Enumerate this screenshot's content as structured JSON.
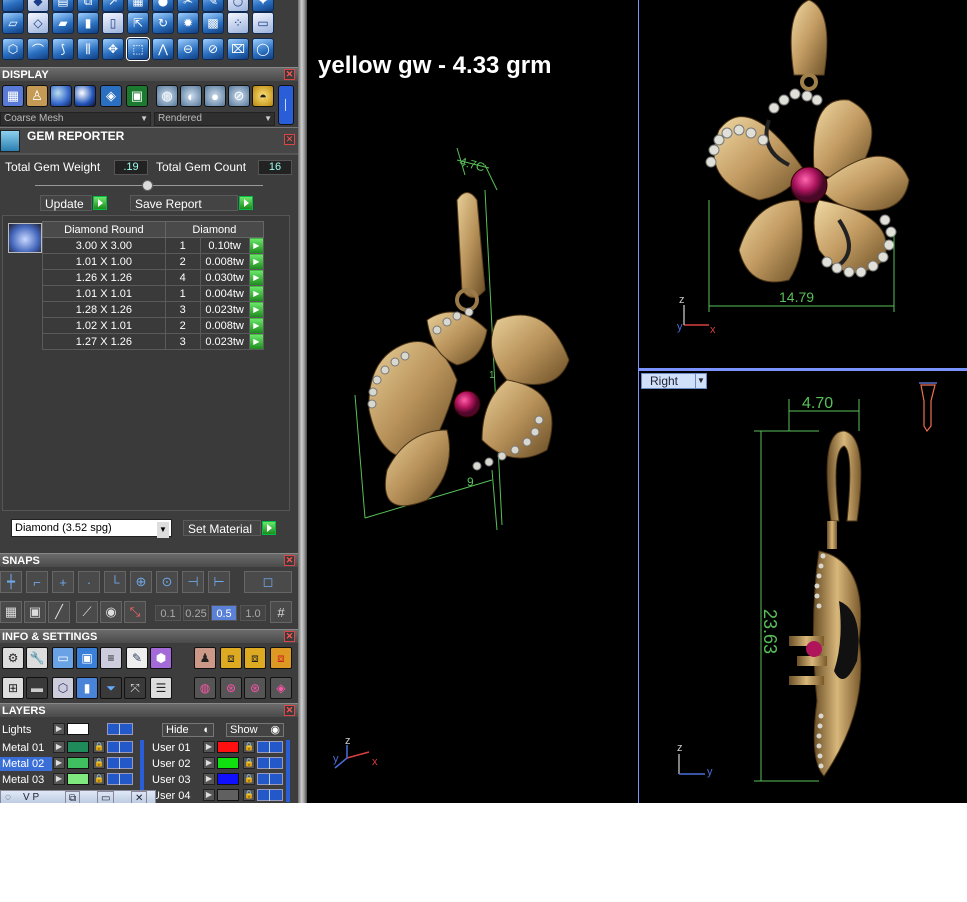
{
  "display": {
    "header": "DISPLAY",
    "mesh_mode": "Coarse Mesh",
    "render_mode": "Rendered"
  },
  "gem_reporter": {
    "header": "GEM REPORTER",
    "total_gem_weight_label": "Total Gem Weight",
    "total_gem_weight": ".19",
    "total_gem_count_label": "Total Gem Count",
    "total_gem_count": "16",
    "update_label": "Update",
    "save_report_label": "Save Report",
    "table": {
      "col_shape": "Diamond Round",
      "col_material": "Diamond",
      "rows": [
        {
          "size": "3.00 X 3.00",
          "count": "1",
          "weight": "0.10tw"
        },
        {
          "size": "1.01 X 1.00",
          "count": "2",
          "weight": "0.008tw"
        },
        {
          "size": "1.26 X 1.26",
          "count": "4",
          "weight": "0.030tw"
        },
        {
          "size": "1.01 X 1.01",
          "count": "1",
          "weight": "0.004tw"
        },
        {
          "size": "1.28 X 1.26",
          "count": "3",
          "weight": "0.023tw"
        },
        {
          "size": "1.02 X 1.01",
          "count": "2",
          "weight": "0.008tw"
        },
        {
          "size": "1.27 X 1.26",
          "count": "3",
          "weight": "0.023tw"
        }
      ]
    },
    "material_select": "Diamond     (3.52 spg)",
    "set_material_label": "Set Material"
  },
  "snaps": {
    "header": "SNAPS",
    "grid_values": [
      "0.1",
      "0.25",
      "0.5",
      "1.0"
    ],
    "grid_selected": "0.5"
  },
  "info_settings": {
    "header": "INFO & SETTINGS"
  },
  "layers": {
    "header": "LAYERS",
    "lights_label": "Lights",
    "hide_label": "Hide",
    "show_label": "Show",
    "left": [
      {
        "name": "Metal 01",
        "color": "#1f8a5a"
      },
      {
        "name": "Metal 02",
        "color": "#3fbf5f",
        "selected": true
      },
      {
        "name": "Metal 03",
        "color": "#7fe87f"
      }
    ],
    "right": [
      {
        "name": "User 01",
        "color": "#ff1010"
      },
      {
        "name": "User 02",
        "color": "#10e010"
      },
      {
        "name": "User 03",
        "color": "#1010ff"
      },
      {
        "name": "User 04",
        "color": "#606060"
      }
    ],
    "taskbar_label": "V P"
  },
  "viewport_main": {
    "caption": "yellow gw - 4.33 grm",
    "dim_top": "4.7C",
    "dim_mid": "9",
    "dim_small": "1"
  },
  "viewport_front": {
    "dim_width": "14.79"
  },
  "viewport_right": {
    "view_label": "Right",
    "dim_depth": "4.70",
    "dim_height": "23.63"
  },
  "axes": {
    "x": "x",
    "y": "y",
    "z": "z"
  }
}
